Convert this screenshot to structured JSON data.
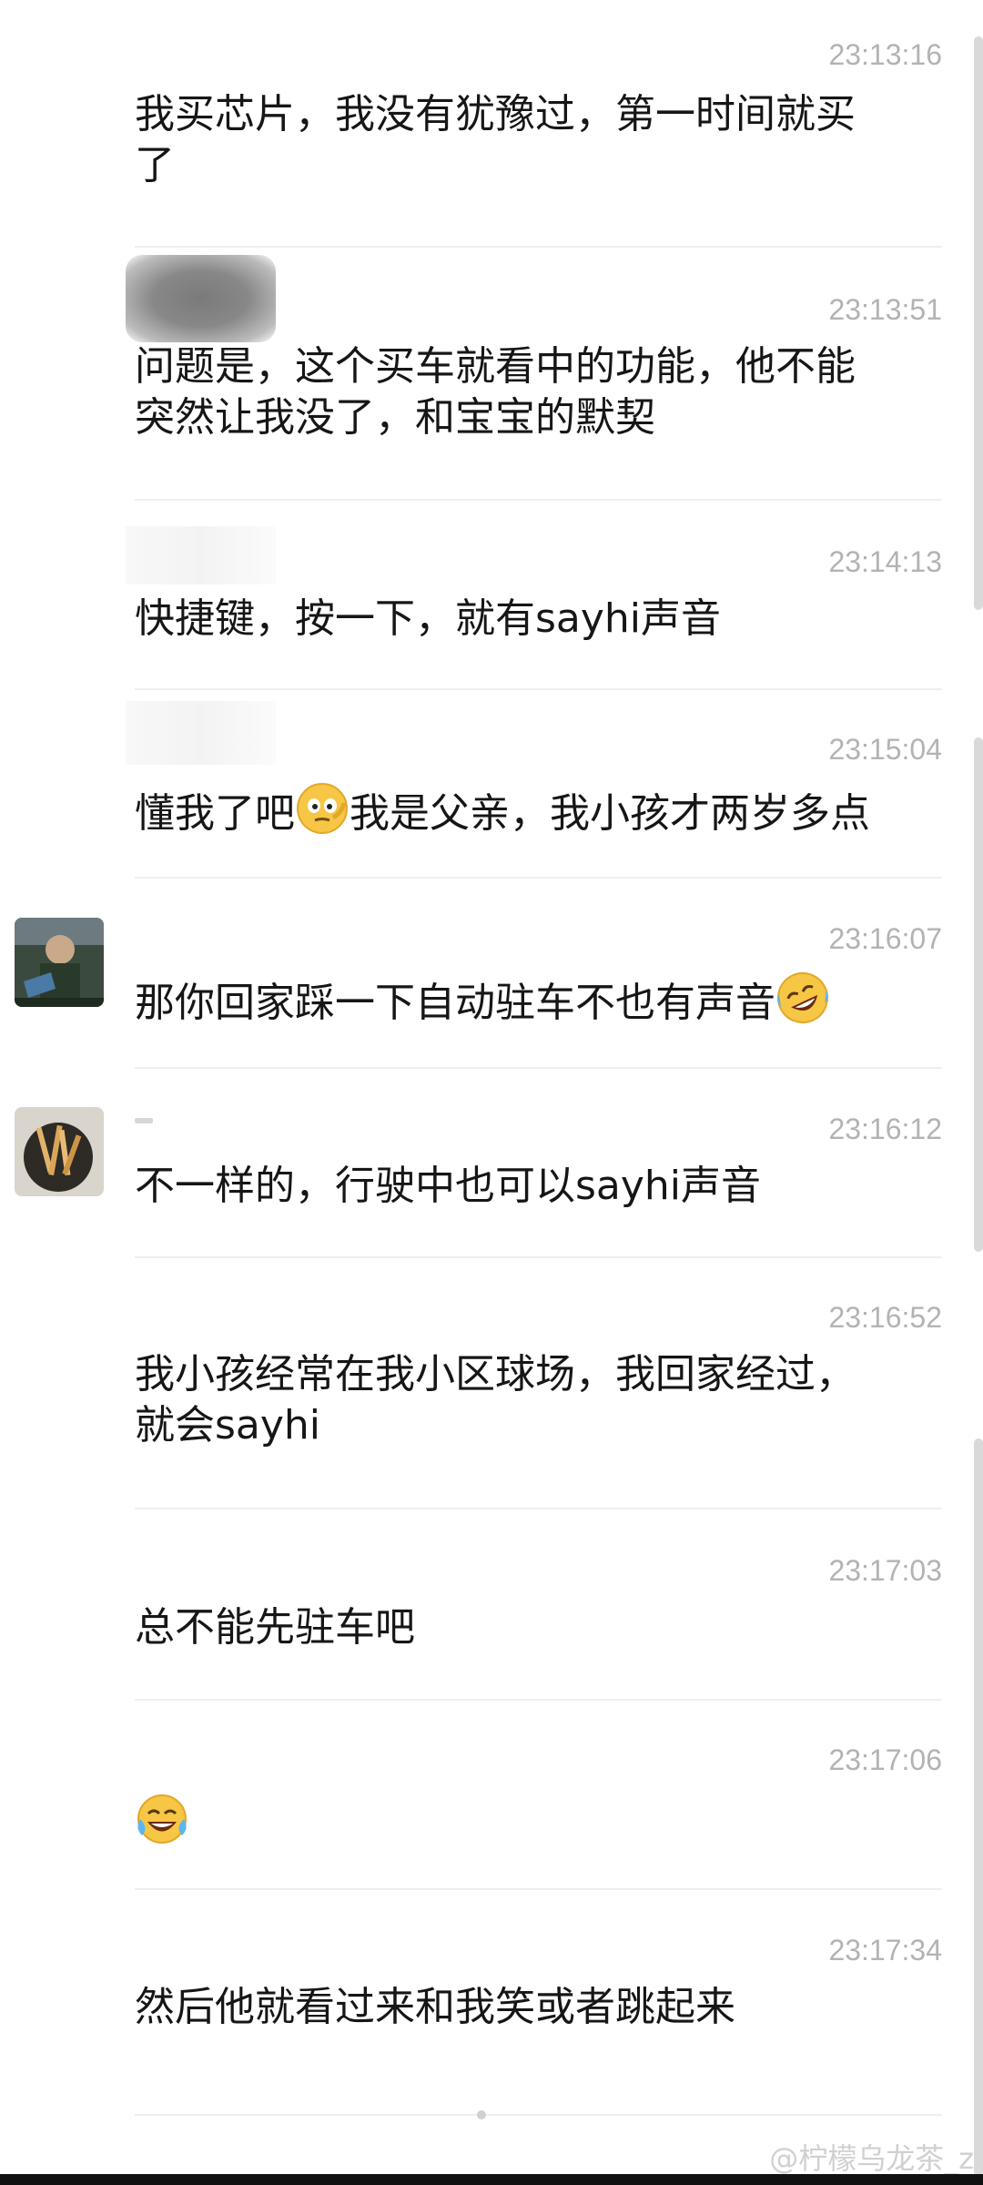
{
  "messages": [
    {
      "time": "23:13:16",
      "text": "我买芯片，我没有犹豫过，第一时间就买\n了"
    },
    {
      "time": "23:13:51",
      "text": "问题是，这个买车就看中的功能，他不能\n突然让我没了，和宝宝的默契"
    },
    {
      "time": "23:14:13",
      "text": "快捷键，按一下，就有sayhi声音"
    },
    {
      "time": "23:15:04",
      "text_before": "懂我了吧",
      "text_after": "我是父亲，我小孩才两岁多点",
      "emoji": "thinking-face-icon"
    },
    {
      "time": "23:16:07",
      "text_before": "那你回家踩一下自动驻车不也有声音",
      "emoji": "rolling-laughing-icon"
    },
    {
      "time": "23:16:12",
      "text": "不一样的，行驶中也可以sayhi声音"
    },
    {
      "time": "23:16:52",
      "text": "我小孩经常在我小区球场，我回家经过，\n就会sayhi"
    },
    {
      "time": "23:17:03",
      "text": "总不能先驻车吧"
    },
    {
      "time": "23:17:06",
      "emoji": "tears-of-joy-icon"
    },
    {
      "time": "23:17:34",
      "text": "然后他就看过来和我笑或者跳起来"
    }
  ],
  "watermark": "@柠檬乌龙茶_z"
}
